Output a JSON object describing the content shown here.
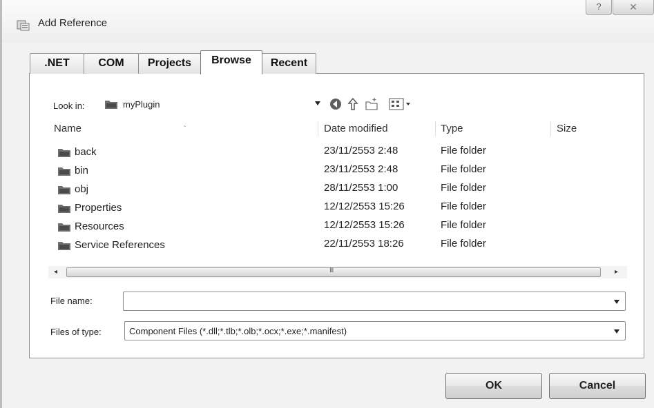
{
  "window": {
    "title": "Add Reference",
    "help_glyph": "?",
    "close_glyph": "✕"
  },
  "tabs": [
    {
      "label": ".NET"
    },
    {
      "label": "COM"
    },
    {
      "label": "Projects"
    },
    {
      "label": "Browse"
    },
    {
      "label": "Recent"
    }
  ],
  "active_tab": "Browse",
  "lookin": {
    "label": "Look in:",
    "value": "myPlugin"
  },
  "toolbar_icons": [
    "back-icon",
    "up-folder-icon",
    "new-folder-icon",
    "view-menu-icon"
  ],
  "columns": {
    "name": "Name",
    "date": "Date modified",
    "type": "Type",
    "size": "Size"
  },
  "files": [
    {
      "name": "back",
      "date": "23/11/2553 2:48",
      "type": "File folder"
    },
    {
      "name": "bin",
      "date": "23/11/2553 2:48",
      "type": "File folder"
    },
    {
      "name": "obj",
      "date": "28/11/2553 1:00",
      "type": "File folder"
    },
    {
      "name": "Properties",
      "date": "12/12/2553 15:26",
      "type": "File folder"
    },
    {
      "name": "Resources",
      "date": "12/12/2553 15:26",
      "type": "File folder"
    },
    {
      "name": "Service References",
      "date": "22/11/2553 18:26",
      "type": "File folder"
    }
  ],
  "scrollbar": {
    "left_arrow": "◂",
    "right_arrow": "▸",
    "grip": "III"
  },
  "file_name": {
    "label": "File name:",
    "value": ""
  },
  "file_type": {
    "label": "Files of type:",
    "value": "Component Files (*.dll;*.tlb;*.olb;*.ocx;*.exe;*.manifest)"
  },
  "buttons": {
    "ok": "OK",
    "cancel": "Cancel"
  },
  "colors": {
    "folder": "#6f6f6f",
    "panel_border": "#8f8f8f"
  }
}
